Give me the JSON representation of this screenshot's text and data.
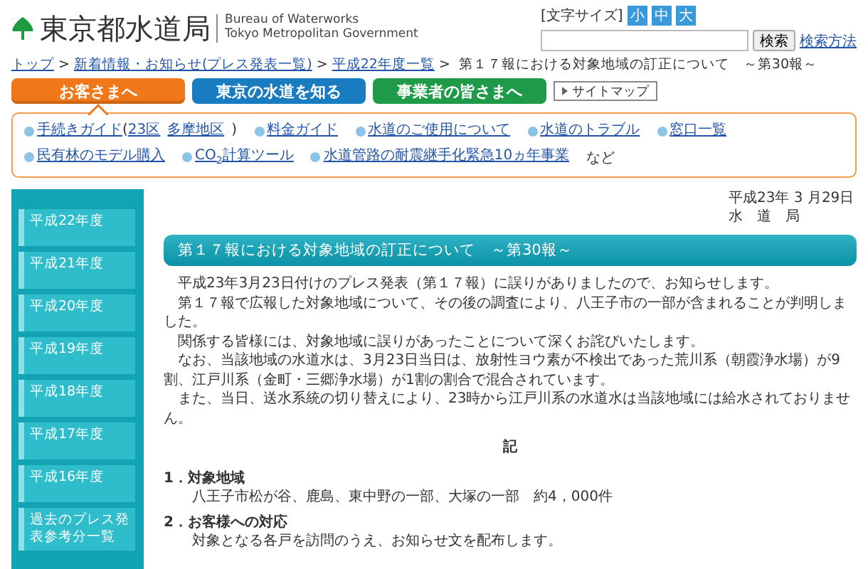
{
  "header": {
    "logo_title": "東京都水道局",
    "logo_subtitle": [
      "Bureau of Waterworks",
      "Tokyo Metropolitan Government"
    ],
    "font_size_label": "[文字サイズ]",
    "font_sizes": [
      "小",
      "中",
      "大"
    ],
    "search_button": "検索",
    "search_help": "検索方法"
  },
  "breadcrumb": [
    {
      "kind": "link",
      "text": "トップ"
    },
    {
      "kind": "separator",
      "text": ">"
    },
    {
      "kind": "link",
      "text": "新着情報・お知らせ(プレス発表一覧)"
    },
    {
      "kind": "separator",
      "text": ">"
    },
    {
      "kind": "link",
      "text": "平成22年度一覧"
    },
    {
      "kind": "separator",
      "text": ">"
    },
    {
      "kind": "current",
      "text": "第１７報における対象地域の訂正について　～第30報～"
    }
  ],
  "nav": {
    "tabs": [
      {
        "label": "お客さまへ",
        "color": "#f07818",
        "selected": true
      },
      {
        "label": "東京の水道を知る",
        "color": "#1a7cc0",
        "selected": false
      },
      {
        "label": "事業者の皆さまへ",
        "color": "#1f9a48",
        "selected": false
      }
    ],
    "sitemap": "サイトマップ"
  },
  "quick_links": {
    "items": [
      {
        "label": "手続きガイド",
        "sub_open": "(",
        "sublinks": [
          "23区",
          "多摩地区"
        ],
        "sub_close": ")"
      },
      {
        "label": "料金ガイド"
      },
      {
        "label": "水道のご使用について"
      },
      {
        "label": "水道のトラブル"
      },
      {
        "label": "窓口一覧"
      },
      {
        "label": "民有林のモデル購入"
      },
      {
        "label": "CO$_{2}$計算ツール"
      },
      {
        "label": "水道管路の耐震継手化緊急10ヵ年事業"
      }
    ],
    "suffix": "など"
  },
  "sidebar": {
    "items": [
      "平成22年度",
      "平成21年度",
      "平成20年度",
      "平成19年度",
      "平成18年度",
      "平成17年度",
      "平成16年度",
      "過去のプレス発表参考分一覧"
    ]
  },
  "article": {
    "date": "平成23年 3 月29日",
    "issuer": "水　道　局",
    "title": "第１７報における対象地域の訂正について　～第30報～",
    "paragraphs": [
      "平成23年3月23日付けのプレス発表（第１７報）に誤りがありましたので、お知らせします。",
      "第１７報で広報した対象地域について、その後の調査により、八王子市の一部が含まれることが判明しました。",
      "関係する皆様には、対象地域に誤りがあったことについて深くお詫びいたします。",
      "なお、当該地域の水道水は、3月23日当日は、放射性ヨウ素が不検出であった荒川系（朝霞浄水場）が9割、江戸川系（金町・三郷浄水場）が1割の割合で混合されています。",
      "また、当日、送水系統の切り替えにより、23時から江戸川系の水道水は当該地域には給水されておりません。"
    ],
    "note_heading": "記",
    "sections": [
      {
        "heading": "1．対象地域",
        "body": "八王子市松が谷、鹿島、東中野の一部、大塚の一部　約4，000件"
      },
      {
        "heading": "2．お客様への対応",
        "body": "対象となる各戸を訪問のうえ、お知らせ文を配布します。"
      }
    ]
  }
}
